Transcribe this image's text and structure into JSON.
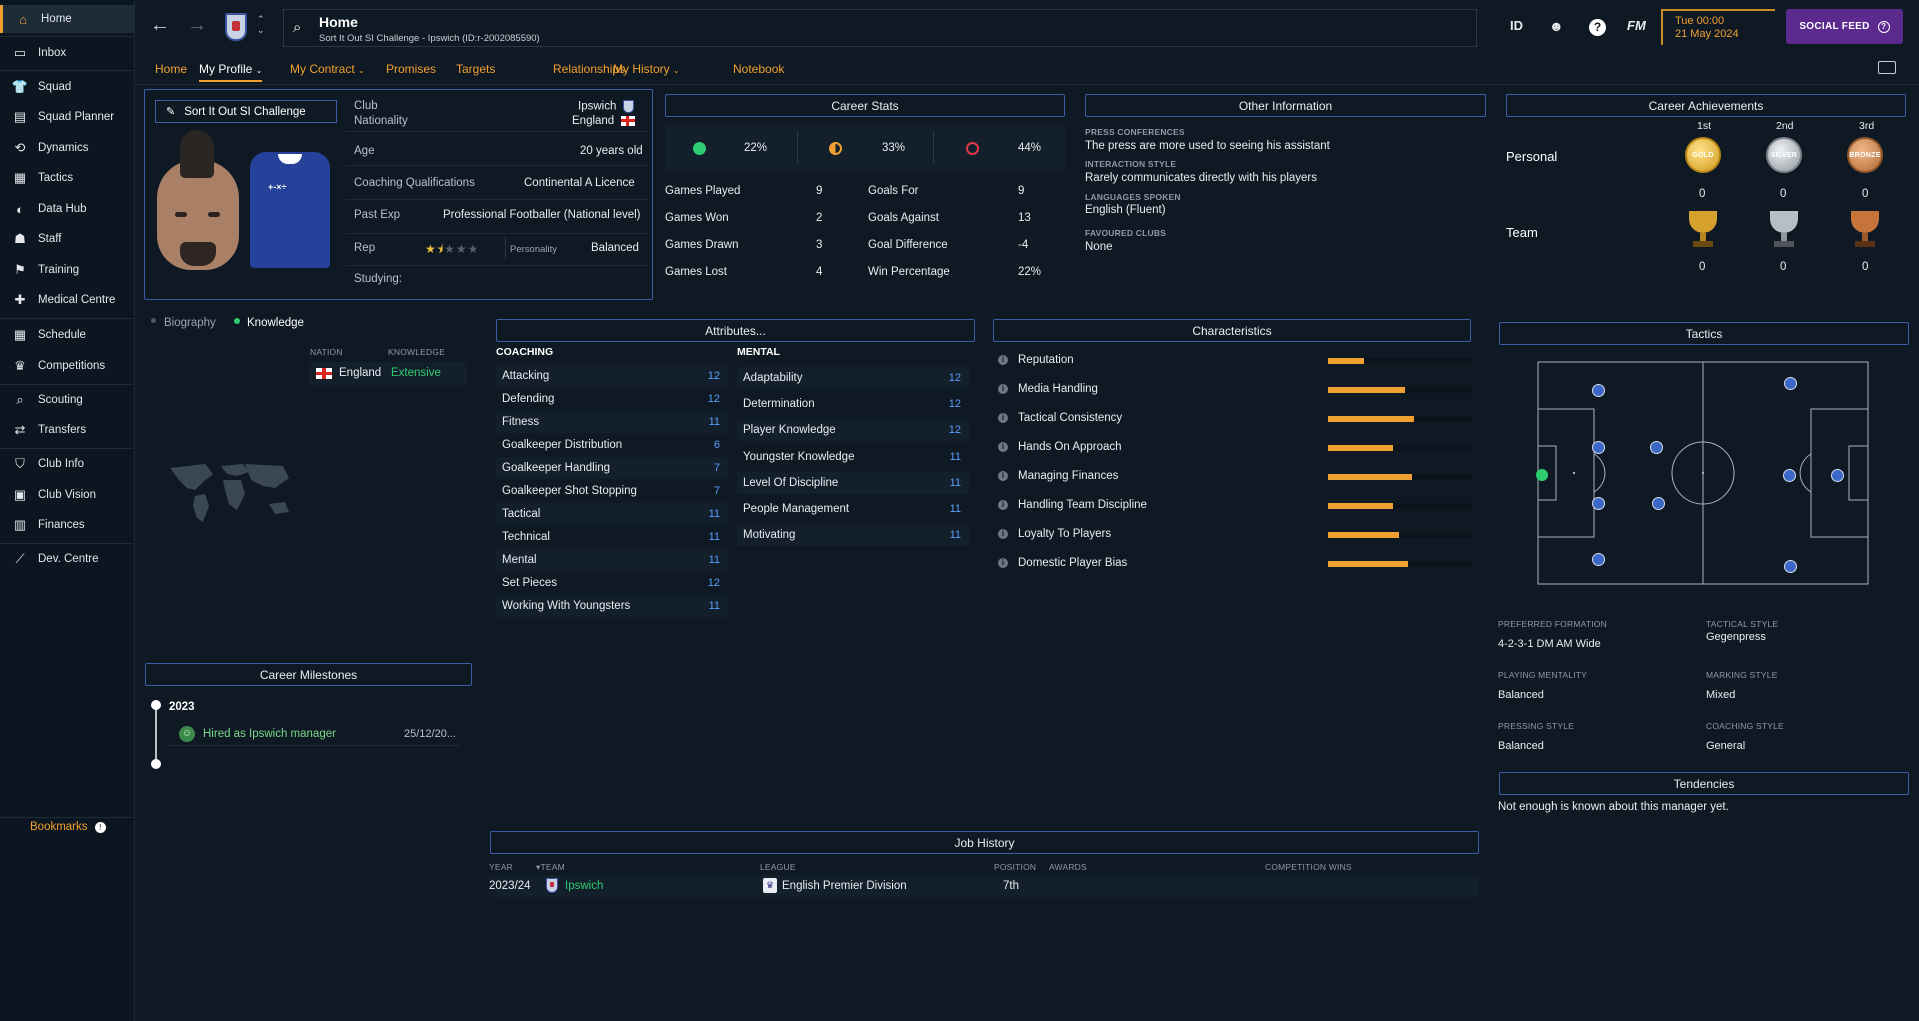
{
  "sidebar": {
    "items": [
      {
        "label": "Home",
        "icon": "home-icon"
      },
      {
        "label": "Inbox",
        "icon": "inbox-icon"
      },
      {
        "label": "Squad",
        "icon": "shirt-icon"
      },
      {
        "label": "Squad Planner",
        "icon": "planner-icon"
      },
      {
        "label": "Dynamics",
        "icon": "dynamics-icon"
      },
      {
        "label": "Tactics",
        "icon": "tactics-icon"
      },
      {
        "label": "Data Hub",
        "icon": "data-hub-icon"
      },
      {
        "label": "Staff",
        "icon": "staff-icon"
      },
      {
        "label": "Training",
        "icon": "training-icon"
      },
      {
        "label": "Medical Centre",
        "icon": "medical-icon"
      },
      {
        "label": "Schedule",
        "icon": "calendar-icon"
      },
      {
        "label": "Competitions",
        "icon": "trophy-icon"
      },
      {
        "label": "Scouting",
        "icon": "scouting-icon"
      },
      {
        "label": "Transfers",
        "icon": "transfers-icon"
      },
      {
        "label": "Club Info",
        "icon": "shield-icon"
      },
      {
        "label": "Club Vision",
        "icon": "vision-icon"
      },
      {
        "label": "Finances",
        "icon": "finances-icon"
      },
      {
        "label": "Dev. Centre",
        "icon": "dev-centre-icon"
      }
    ],
    "bookmarks": "Bookmarks"
  },
  "header": {
    "title": "Home",
    "subtitle": "Sort It Out SI Challenge - Ipswich (ID:r-2002085590)",
    "icons": {
      "id": "ID",
      "fm": "FM"
    },
    "date_time": "Tue 00:00",
    "date": "21 May 2024",
    "social_feed": "SOCIAL FEED"
  },
  "tabs": [
    "Home",
    "My Profile",
    "My Contract",
    "Promises",
    "Targets",
    "Relationships",
    "My History",
    "Notebook"
  ],
  "profile": {
    "name": "Sort It Out SI Challenge",
    "club_label": "Club",
    "club": "Ipswich",
    "nationality_label": "Nationality",
    "nationality": "England",
    "age_label": "Age",
    "age": "20 years old",
    "coaching_label": "Coaching Qualifications",
    "coaching": "Continental A Licence",
    "pastexp_label": "Past Exp",
    "pastexp": "Professional Footballer (National level)",
    "rep_label": "Rep",
    "rep_stars": 1.5,
    "personality_label": "Personality",
    "personality": "Balanced",
    "studying_label": "Studying:"
  },
  "career_stats": {
    "title": "Career Stats",
    "win_pct": "22%",
    "draw_pct": "33%",
    "loss_pct": "44%",
    "left": [
      {
        "label": "Games Played",
        "value": "9"
      },
      {
        "label": "Games Won",
        "value": "2"
      },
      {
        "label": "Games Drawn",
        "value": "3"
      },
      {
        "label": "Games Lost",
        "value": "4"
      }
    ],
    "right": [
      {
        "label": "Goals For",
        "value": "9"
      },
      {
        "label": "Goals Against",
        "value": "13"
      },
      {
        "label": "Goal Difference",
        "value": "-4"
      },
      {
        "label": "Win Percentage",
        "value": "22%"
      }
    ]
  },
  "other_info": {
    "title": "Other Information",
    "press_label": "PRESS CONFERENCES",
    "press": "The press are more used to seeing his assistant",
    "interaction_label": "INTERACTION STYLE",
    "interaction": "Rarely communicates directly with his players",
    "languages_label": "LANGUAGES SPOKEN",
    "languages": "English (Fluent)",
    "clubs_label": "FAVOURED CLUBS",
    "clubs": "None"
  },
  "achievements": {
    "title": "Career Achievements",
    "places": [
      "1st",
      "2nd",
      "3rd"
    ],
    "personal_label": "Personal",
    "team_label": "Team",
    "medals": [
      "GOLD",
      "SILVER",
      "BRONZE"
    ],
    "personal_counts": [
      "0",
      "0",
      "0"
    ],
    "team_counts": [
      "0",
      "0",
      "0"
    ]
  },
  "knowledge": {
    "tab_bio": "Biography",
    "tab_knowledge": "Knowledge",
    "nation_header": "NATION",
    "knowledge_header": "KNOWLEDGE",
    "nation": "England",
    "level": "Extensive"
  },
  "attributes": {
    "title": "Attributes...",
    "coaching_header": "COACHING",
    "mental_header": "MENTAL",
    "coaching": [
      {
        "label": "Attacking",
        "value": "12"
      },
      {
        "label": "Defending",
        "value": "12"
      },
      {
        "label": "Fitness",
        "value": "11"
      },
      {
        "label": "Goalkeeper Distribution",
        "value": "6"
      },
      {
        "label": "Goalkeeper Handling",
        "value": "7"
      },
      {
        "label": "Goalkeeper Shot Stopping",
        "value": "7"
      },
      {
        "label": "Tactical",
        "value": "11"
      },
      {
        "label": "Technical",
        "value": "11"
      },
      {
        "label": "Mental",
        "value": "11"
      },
      {
        "label": "Set Pieces",
        "value": "12"
      },
      {
        "label": "Working With Youngsters",
        "value": "11"
      }
    ],
    "mental": [
      {
        "label": "Adaptability",
        "value": "12"
      },
      {
        "label": "Determination",
        "value": "12"
      },
      {
        "label": "Player Knowledge",
        "value": "12"
      },
      {
        "label": "Youngster Knowledge",
        "value": "11"
      },
      {
        "label": "Level Of Discipline",
        "value": "11"
      },
      {
        "label": "People Management",
        "value": "11"
      },
      {
        "label": "Motivating",
        "value": "11"
      }
    ]
  },
  "characteristics": {
    "title": "Characteristics",
    "items": [
      {
        "label": "Reputation",
        "level": 0.25
      },
      {
        "label": "Media Handling",
        "level": 0.53
      },
      {
        "label": "Tactical Consistency",
        "level": 0.59
      },
      {
        "label": "Hands On Approach",
        "level": 0.45
      },
      {
        "label": "Managing Finances",
        "level": 0.58
      },
      {
        "label": "Handling Team Discipline",
        "level": 0.45
      },
      {
        "label": "Loyalty To Players",
        "level": 0.49
      },
      {
        "label": "Domestic Player Bias",
        "level": 0.55
      }
    ]
  },
  "tactics": {
    "title": "Tactics",
    "formation_label": "PREFERRED FORMATION",
    "formation": "4-2-3-1 DM AM Wide",
    "style_label": "TACTICAL STYLE",
    "style": "Gegenpress",
    "mentality_label": "PLAYING MENTALITY",
    "mentality": "Balanced",
    "marking_label": "MARKING STYLE",
    "marking": "Mixed",
    "pressing_label": "PRESSING STYLE",
    "pressing": "Balanced",
    "coaching_label": "COACHING STYLE",
    "coaching": "General"
  },
  "tendencies": {
    "title": "Tendencies",
    "text": "Not enough is known about this manager yet."
  },
  "milestones": {
    "title": "Career Milestones",
    "year": "2023",
    "event": "Hired as Ipswich manager",
    "date": "25/12/20..."
  },
  "job_history": {
    "title": "Job History",
    "headers": {
      "year": "YEAR",
      "team": "TEAM",
      "league": "LEAGUE",
      "position": "POSITION",
      "awards": "AWARDS",
      "wins": "COMPETITION WINS"
    },
    "rows": [
      {
        "year": "2023/24",
        "team": "Ipswich",
        "league": "English Premier Division",
        "position": "7th"
      }
    ]
  },
  "colors": {
    "accent": "#f0a030",
    "win": "#2ecc71",
    "draw": "#f0a030",
    "loss": "#e0394a",
    "link_blue": "#5aa0ff",
    "panel_border": "#3a5ea8"
  }
}
